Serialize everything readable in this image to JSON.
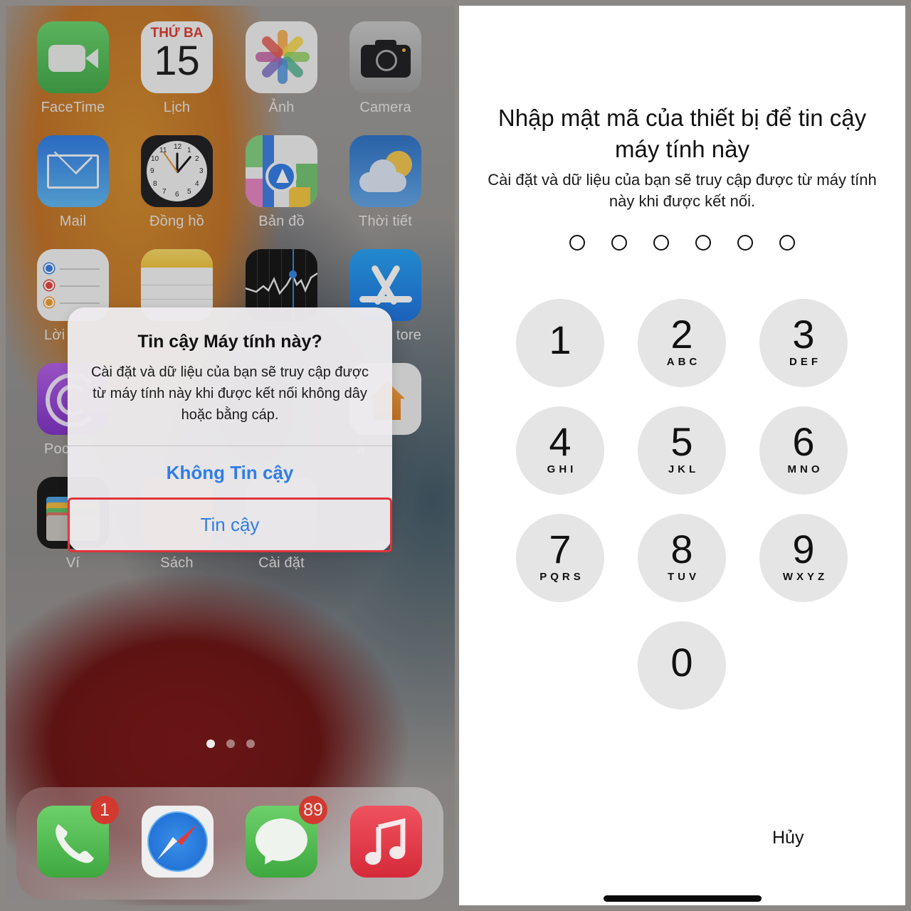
{
  "home_screen": {
    "apps": [
      {
        "label": "FaceTime",
        "icon": "facetime-icon"
      },
      {
        "label": "Lịch",
        "icon": "calendar-icon",
        "calendar_day": "THỨ BA",
        "calendar_date": "15"
      },
      {
        "label": "Ảnh",
        "icon": "photos-icon"
      },
      {
        "label": "Camera",
        "icon": "camera-icon"
      },
      {
        "label": "Mail",
        "icon": "mail-icon"
      },
      {
        "label": "Đồng hồ",
        "icon": "clock-icon"
      },
      {
        "label": "Bản đồ",
        "icon": "maps-icon"
      },
      {
        "label": "Thời tiết",
        "icon": "weather-icon"
      },
      {
        "label": "Lời",
        "icon": "reminders-icon"
      },
      {
        "label": "",
        "icon": "notes-icon"
      },
      {
        "label": "",
        "icon": "stocks-icon"
      },
      {
        "label": "tore",
        "icon": "app-store-icon"
      },
      {
        "label": "Poc",
        "icon": "podcasts-icon"
      },
      {
        "label": "à",
        "icon": "home-app-icon"
      },
      {
        "label": "Ví",
        "icon": "wallet-icon"
      },
      {
        "label": "Sách",
        "icon": "books-icon"
      },
      {
        "label": "Cài đặt",
        "icon": "settings-icon"
      }
    ],
    "page_indicator": {
      "total": 3,
      "active": 1
    },
    "dock": [
      {
        "icon": "phone-icon",
        "badge": "1"
      },
      {
        "icon": "safari-icon",
        "badge": null
      },
      {
        "icon": "messages-icon",
        "badge": "89"
      },
      {
        "icon": "music-icon",
        "badge": null
      }
    ]
  },
  "alert": {
    "title": "Tin cậy Máy tính này?",
    "message": "Cài đặt và dữ liệu của bạn sẽ truy cập được từ máy tính này khi được kết nối không dây hoặc bằng cáp.",
    "dont_trust_label": "Không Tin cậy",
    "trust_label": "Tin cậy",
    "accent_color": "#2f7de8",
    "highlight_color": "#e0353a"
  },
  "passcode": {
    "title": "Nhập mật mã của thiết bị để tin cậy máy tính này",
    "subtitle": "Cài đặt và dữ liệu của bạn sẽ truy cập được từ máy tính này khi được kết nối.",
    "digits_total": 6,
    "digits_entered": 0,
    "keys": [
      {
        "digit": "1",
        "letters": ""
      },
      {
        "digit": "2",
        "letters": "ABC"
      },
      {
        "digit": "3",
        "letters": "DEF"
      },
      {
        "digit": "4",
        "letters": "GHI"
      },
      {
        "digit": "5",
        "letters": "JKL"
      },
      {
        "digit": "6",
        "letters": "MNO"
      },
      {
        "digit": "7",
        "letters": "PQRS"
      },
      {
        "digit": "8",
        "letters": "TUV"
      },
      {
        "digit": "9",
        "letters": "WXYZ"
      },
      {
        "digit": "0",
        "letters": ""
      }
    ],
    "cancel_label": "Hủy"
  }
}
